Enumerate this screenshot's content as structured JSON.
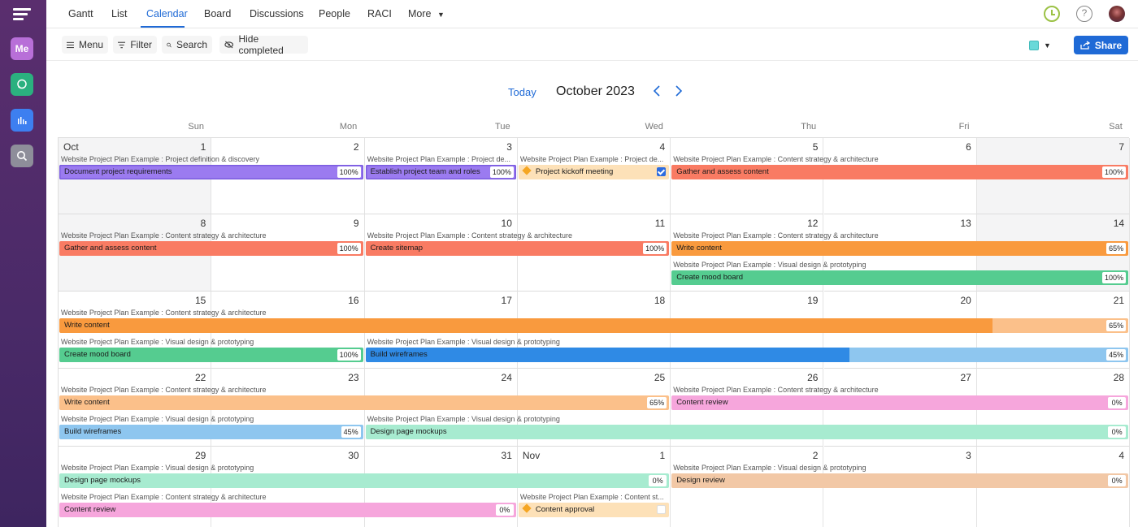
{
  "nav": {
    "tabs": [
      {
        "label": "Gantt"
      },
      {
        "label": "List"
      },
      {
        "label": "Calendar"
      },
      {
        "label": "Board"
      },
      {
        "label": "Discussions"
      },
      {
        "label": "People"
      },
      {
        "label": "RACI"
      },
      {
        "label": "More"
      }
    ],
    "active_tab": "Calendar",
    "help_symbol": "?"
  },
  "sidebar": {
    "me_label": "Me"
  },
  "toolbar": {
    "menu": "Menu",
    "filter": "Filter",
    "search": "Search",
    "hide_completed": "Hide completed",
    "share": "Share",
    "color": "#6ad9d9"
  },
  "calendar": {
    "today": "Today",
    "month": "October 2023",
    "days_of_week": [
      "Sun",
      "Mon",
      "Tue",
      "Wed",
      "Thu",
      "Fri",
      "Sat"
    ],
    "weeks": [
      [
        "1",
        "2",
        "3",
        "4",
        "5",
        "6",
        "7"
      ],
      [
        "8",
        "9",
        "10",
        "11",
        "12",
        "13",
        "14"
      ],
      [
        "15",
        "16",
        "17",
        "18",
        "19",
        "20",
        "21"
      ],
      [
        "22",
        "23",
        "24",
        "25",
        "26",
        "27",
        "28"
      ],
      [
        "29",
        "30",
        "31",
        "1",
        "2",
        "3",
        "4"
      ]
    ],
    "month_labels": {
      "oct": "Oct",
      "nov": "Nov"
    }
  },
  "tasks": [
    {
      "ctx": "Website Project Plan Example : Project definition & discovery",
      "name": "Document project requirements",
      "pct": "100%",
      "progress": 1.0
    },
    {
      "ctx": "Website Project Plan Example : Project de...",
      "name": "Establish project team and roles",
      "pct": "100%",
      "progress": 1.0
    },
    {
      "ctx": "Website Project Plan Example : Project de...",
      "name": "Project kickoff meeting",
      "milestone": true,
      "done": true
    },
    {
      "ctx": "Website Project Plan Example : Content strategy & architecture",
      "name": "Gather and assess content",
      "pct": "100%",
      "progress": 1.0
    },
    {
      "ctx": "Website Project Plan Example : Content strategy & architecture",
      "name": "Gather and assess content",
      "pct": "100%",
      "progress": 1.0
    },
    {
      "ctx": "Website Project Plan Example : Content strategy & architecture",
      "name": "Create sitemap",
      "pct": "100%",
      "progress": 1.0
    },
    {
      "ctx": "Website Project Plan Example : Content strategy & architecture",
      "name": "Write content",
      "pct": "65%",
      "progress": 1.0
    },
    {
      "ctx": "Website Project Plan Example : Visual design & prototyping",
      "name": "Create mood board",
      "pct": "100%",
      "progress": 1.0
    },
    {
      "ctx": "Website Project Plan Example : Content strategy & architecture",
      "name": "Write content",
      "pct": "65%",
      "progress": 0.873
    },
    {
      "ctx": "Website Project Plan Example : Visual design & prototyping",
      "name": "Create mood board",
      "pct": "100%",
      "progress": 1.0
    },
    {
      "ctx": "Website Project Plan Example : Visual design & prototyping",
      "name": "Build wireframes",
      "pct": "45%",
      "progress": 0.634
    },
    {
      "ctx": "Website Project Plan Example : Content strategy & architecture",
      "name": "Write content",
      "pct": "65%",
      "progress": 0.0
    },
    {
      "ctx": "Website Project Plan Example : Content strategy & architecture",
      "name": "Content review",
      "pct": "0%",
      "progress": 0.0
    },
    {
      "ctx": "Website Project Plan Example : Visual design & prototyping",
      "name": "Build wireframes",
      "pct": "45%",
      "progress": 0.0
    },
    {
      "ctx": "Website Project Plan Example : Visual design & prototyping",
      "name": "Design page mockups",
      "pct": "0%",
      "progress": 0.0
    },
    {
      "ctx": "Website Project Plan Example : Visual design & prototyping",
      "name": "Design page mockups",
      "pct": "0%",
      "progress": 0.0
    },
    {
      "ctx": "Website Project Plan Example : Visual design & prototyping",
      "name": "Design review",
      "pct": "0%",
      "progress": 0.0
    },
    {
      "ctx": "Website Project Plan Example : Content strategy & architecture",
      "name": "Content review",
      "pct": "0%",
      "progress": 0.0
    },
    {
      "ctx": "Website Project Plan Example : Content st...",
      "name": "Content approval",
      "milestone": true,
      "done": false
    }
  ],
  "colors": {
    "purple": "#9b7bf0",
    "coral": "#f97b63",
    "orange": "#f99a3e",
    "orange_light": "#fbc08a",
    "green": "#55cc90",
    "blue": "#2f8ae5",
    "blue_light": "#8ec6ef",
    "mint": "#a7ebd0",
    "pink": "#f6a6dc",
    "peach": "#f2c8a6",
    "milestone_bg": "#fde1b8",
    "accent": "#1f6ad6"
  }
}
